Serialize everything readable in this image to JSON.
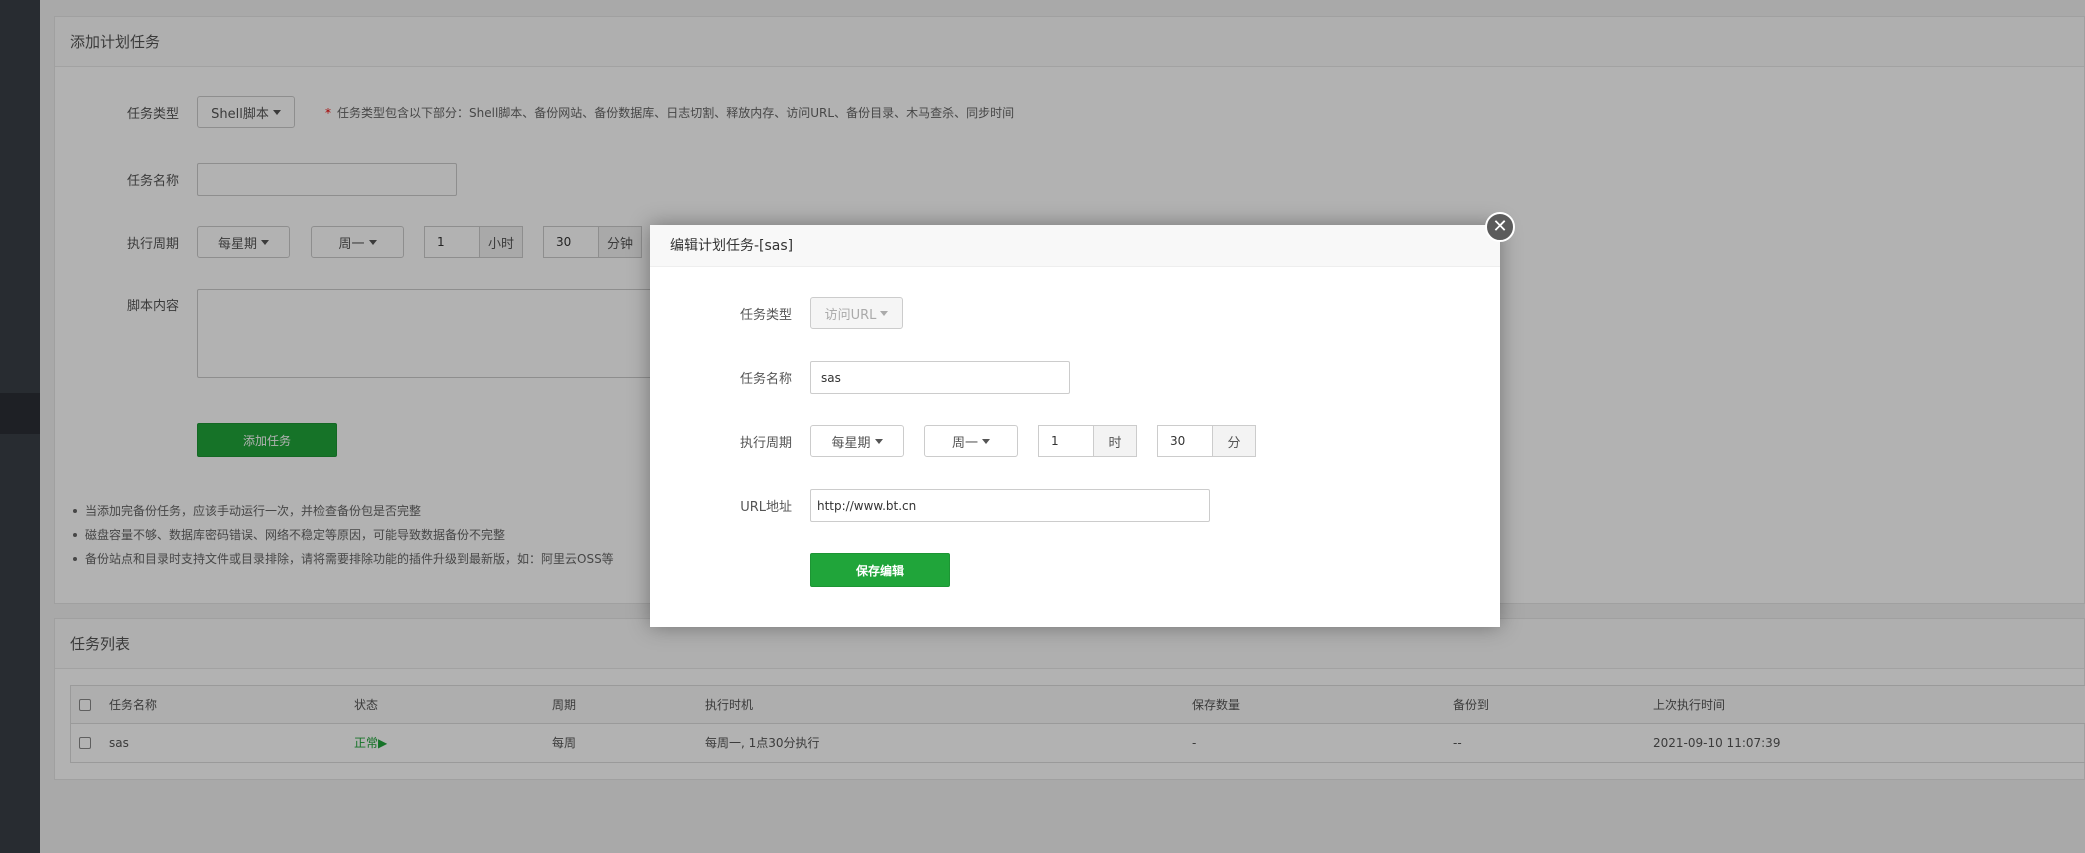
{
  "add_task": {
    "title": "添加计划任务",
    "type_label": "任务类型",
    "type_value": "Shell脚本",
    "type_hint": "任务类型包含以下部分：Shell脚本、备份网站、备份数据库、日志切割、释放内存、访问URL、备份目录、木马查杀、同步时间",
    "name_label": "任务名称",
    "name_value": "",
    "cycle_label": "执行周期",
    "cycle_value": "每星期",
    "weekday_value": "周一",
    "hour_value": "1",
    "hour_unit": "小时",
    "minute_value": "30",
    "minute_unit": "分钟",
    "script_label": "脚本内容",
    "script_value": "",
    "submit_label": "添加任务",
    "tips": [
      "当添加完备份任务，应该手动运行一次，并检查备份包是否完整",
      "磁盘容量不够、数据库密码错误、网络不稳定等原因，可能导致数据备份不完整",
      "备份站点和目录时支持文件或目录排除，请将需要排除功能的插件升级到最新版，如：阿里云OSS等"
    ]
  },
  "task_list": {
    "title": "任务列表",
    "columns": [
      "任务名称",
      "状态",
      "周期",
      "执行时机",
      "保存数量",
      "备份到",
      "上次执行时间"
    ],
    "rows": [
      {
        "name": "sas",
        "status": "正常",
        "status_icon": "play-icon",
        "cycle": "每周",
        "timing": "每周一, 1点30分执行",
        "save_count": "-",
        "backup_to": "--",
        "last_run": "2021-09-10 11:07:39"
      }
    ]
  },
  "modal": {
    "title": "编辑计划任务-[sas]",
    "type_label": "任务类型",
    "type_value": "访问URL",
    "name_label": "任务名称",
    "name_value": "sas",
    "cycle_label": "执行周期",
    "cycle_value": "每星期",
    "weekday_value": "周一",
    "hour_value": "1",
    "hour_unit": "时",
    "minute_value": "30",
    "minute_unit": "分",
    "url_label": "URL地址",
    "url_value": "http://www.bt.cn",
    "save_label": "保存编辑",
    "close_icon": "close-icon"
  },
  "colors": {
    "accent_green": "#20a53a",
    "sidebar": "#3a3f47"
  }
}
